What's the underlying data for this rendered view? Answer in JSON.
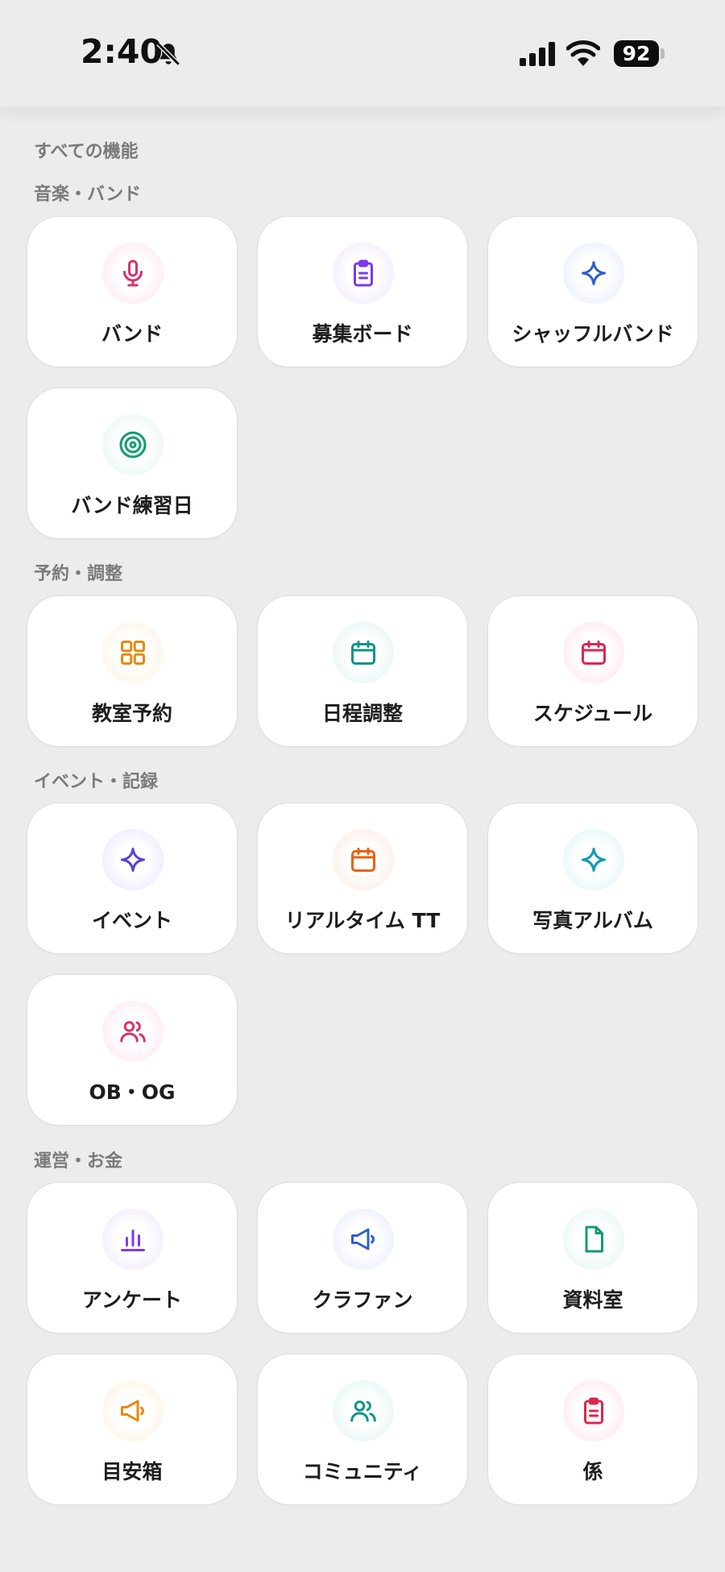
{
  "status_bar": {
    "time": "2:40",
    "battery": "92"
  },
  "page_title": "すべての機能",
  "sections": [
    {
      "label": "音楽・バンド"
    },
    {
      "label": "予約・調整"
    },
    {
      "label": "イベント・記録"
    },
    {
      "label": "運営・お金"
    }
  ],
  "tiles": {
    "band": {
      "label": "バンド",
      "icon": "microphone-icon",
      "color": "#d6336c"
    },
    "recruit_board": {
      "label": "募集ボード",
      "icon": "clipboard-icon",
      "color": "#7c3aed"
    },
    "shuffle_band": {
      "label": "シャッフルバンド",
      "icon": "sparkle-icon",
      "color": "#2f5fd0"
    },
    "band_practice_day": {
      "label": "バンド練習日",
      "icon": "target-icon",
      "color": "#0f9d6e"
    },
    "room_booking": {
      "label": "教室予約",
      "icon": "grid-icon",
      "color": "#e8890c"
    },
    "schedule_adjust": {
      "label": "日程調整",
      "icon": "calendar-icon",
      "color": "#0f9488"
    },
    "schedule": {
      "label": "スケジュール",
      "icon": "calendar-icon",
      "color": "#dc2650"
    },
    "event": {
      "label": "イベント",
      "icon": "sparkle-icon",
      "color": "#5b3fd6"
    },
    "realtime_tt": {
      "label": "リアルタイム TT",
      "icon": "calendar-icon",
      "color": "#e8620c"
    },
    "photo_album": {
      "label": "写真アルバム",
      "icon": "sparkle-icon",
      "color": "#0e9ab0"
    },
    "ob_og": {
      "label": "OB・OG",
      "icon": "people-icon",
      "color": "#d6336c"
    },
    "survey": {
      "label": "アンケート",
      "icon": "bar-chart-icon",
      "color": "#7c3aed"
    },
    "crowdfunding": {
      "label": "クラファン",
      "icon": "megaphone-icon",
      "color": "#2f5fd0"
    },
    "documents": {
      "label": "資料室",
      "icon": "document-icon",
      "color": "#0f9d6e"
    },
    "suggestion_box": {
      "label": "目安箱",
      "icon": "megaphone-icon",
      "color": "#e8890c"
    },
    "community": {
      "label": "コミュニティ",
      "icon": "people-icon",
      "color": "#0f9488"
    },
    "roles": {
      "label": "係",
      "icon": "clipboard-icon",
      "color": "#dc2650"
    }
  }
}
